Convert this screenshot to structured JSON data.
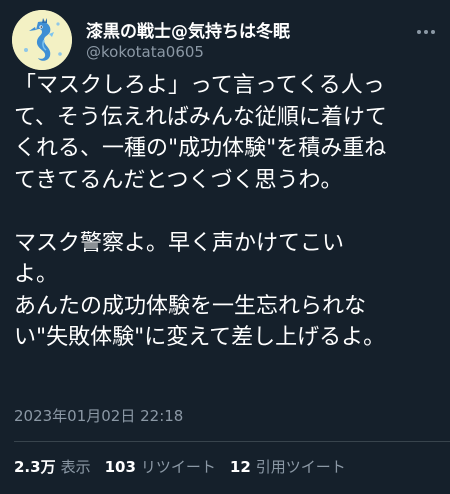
{
  "author": {
    "display_name": "漆黒の戦士@気持ちは冬眠",
    "handle": "@kokotata0605",
    "avatar_icon": "seahorse-avatar-icon"
  },
  "tweet": {
    "paragraph_1": [
      "「マスクしろよ」って言ってくる人っ",
      "て、そう伝えればみんな従順に着けて",
      "くれる、一種の\"成功体験\"を積み重ね",
      "てきてるんだとつくづく思うわ。"
    ],
    "paragraph_2": [
      "マスク警察よ。早く声かけてこい",
      "よ。",
      "あんたの成功体験を一生忘れられな",
      "い\"失敗体験\"に変えて差し上げるよ。"
    ],
    "timestamp": "2023年01月02日 22:18"
  },
  "stats": {
    "views_count": "2.3万",
    "views_label": "表示",
    "retweets_count": "103",
    "retweets_label": "リツイート",
    "quotes_count": "12",
    "quotes_label": "引用ツイート"
  },
  "colors": {
    "background": "#15202b",
    "primary_text": "#ffffff",
    "secondary_text": "#8b98a5",
    "divider": "#38444d"
  }
}
